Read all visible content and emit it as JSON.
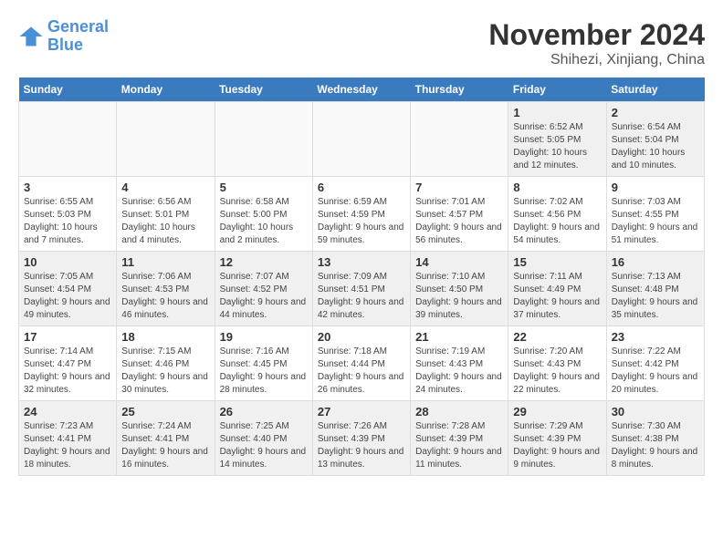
{
  "header": {
    "logo_line1": "General",
    "logo_line2": "Blue",
    "month": "November 2024",
    "location": "Shihezi, Xinjiang, China"
  },
  "weekdays": [
    "Sunday",
    "Monday",
    "Tuesday",
    "Wednesday",
    "Thursday",
    "Friday",
    "Saturday"
  ],
  "weeks": [
    [
      {
        "day": "",
        "info": ""
      },
      {
        "day": "",
        "info": ""
      },
      {
        "day": "",
        "info": ""
      },
      {
        "day": "",
        "info": ""
      },
      {
        "day": "",
        "info": ""
      },
      {
        "day": "1",
        "info": "Sunrise: 6:52 AM\nSunset: 5:05 PM\nDaylight: 10 hours and 12 minutes."
      },
      {
        "day": "2",
        "info": "Sunrise: 6:54 AM\nSunset: 5:04 PM\nDaylight: 10 hours and 10 minutes."
      }
    ],
    [
      {
        "day": "3",
        "info": "Sunrise: 6:55 AM\nSunset: 5:03 PM\nDaylight: 10 hours and 7 minutes."
      },
      {
        "day": "4",
        "info": "Sunrise: 6:56 AM\nSunset: 5:01 PM\nDaylight: 10 hours and 4 minutes."
      },
      {
        "day": "5",
        "info": "Sunrise: 6:58 AM\nSunset: 5:00 PM\nDaylight: 10 hours and 2 minutes."
      },
      {
        "day": "6",
        "info": "Sunrise: 6:59 AM\nSunset: 4:59 PM\nDaylight: 9 hours and 59 minutes."
      },
      {
        "day": "7",
        "info": "Sunrise: 7:01 AM\nSunset: 4:57 PM\nDaylight: 9 hours and 56 minutes."
      },
      {
        "day": "8",
        "info": "Sunrise: 7:02 AM\nSunset: 4:56 PM\nDaylight: 9 hours and 54 minutes."
      },
      {
        "day": "9",
        "info": "Sunrise: 7:03 AM\nSunset: 4:55 PM\nDaylight: 9 hours and 51 minutes."
      }
    ],
    [
      {
        "day": "10",
        "info": "Sunrise: 7:05 AM\nSunset: 4:54 PM\nDaylight: 9 hours and 49 minutes."
      },
      {
        "day": "11",
        "info": "Sunrise: 7:06 AM\nSunset: 4:53 PM\nDaylight: 9 hours and 46 minutes."
      },
      {
        "day": "12",
        "info": "Sunrise: 7:07 AM\nSunset: 4:52 PM\nDaylight: 9 hours and 44 minutes."
      },
      {
        "day": "13",
        "info": "Sunrise: 7:09 AM\nSunset: 4:51 PM\nDaylight: 9 hours and 42 minutes."
      },
      {
        "day": "14",
        "info": "Sunrise: 7:10 AM\nSunset: 4:50 PM\nDaylight: 9 hours and 39 minutes."
      },
      {
        "day": "15",
        "info": "Sunrise: 7:11 AM\nSunset: 4:49 PM\nDaylight: 9 hours and 37 minutes."
      },
      {
        "day": "16",
        "info": "Sunrise: 7:13 AM\nSunset: 4:48 PM\nDaylight: 9 hours and 35 minutes."
      }
    ],
    [
      {
        "day": "17",
        "info": "Sunrise: 7:14 AM\nSunset: 4:47 PM\nDaylight: 9 hours and 32 minutes."
      },
      {
        "day": "18",
        "info": "Sunrise: 7:15 AM\nSunset: 4:46 PM\nDaylight: 9 hours and 30 minutes."
      },
      {
        "day": "19",
        "info": "Sunrise: 7:16 AM\nSunset: 4:45 PM\nDaylight: 9 hours and 28 minutes."
      },
      {
        "day": "20",
        "info": "Sunrise: 7:18 AM\nSunset: 4:44 PM\nDaylight: 9 hours and 26 minutes."
      },
      {
        "day": "21",
        "info": "Sunrise: 7:19 AM\nSunset: 4:43 PM\nDaylight: 9 hours and 24 minutes."
      },
      {
        "day": "22",
        "info": "Sunrise: 7:20 AM\nSunset: 4:43 PM\nDaylight: 9 hours and 22 minutes."
      },
      {
        "day": "23",
        "info": "Sunrise: 7:22 AM\nSunset: 4:42 PM\nDaylight: 9 hours and 20 minutes."
      }
    ],
    [
      {
        "day": "24",
        "info": "Sunrise: 7:23 AM\nSunset: 4:41 PM\nDaylight: 9 hours and 18 minutes."
      },
      {
        "day": "25",
        "info": "Sunrise: 7:24 AM\nSunset: 4:41 PM\nDaylight: 9 hours and 16 minutes."
      },
      {
        "day": "26",
        "info": "Sunrise: 7:25 AM\nSunset: 4:40 PM\nDaylight: 9 hours and 14 minutes."
      },
      {
        "day": "27",
        "info": "Sunrise: 7:26 AM\nSunset: 4:39 PM\nDaylight: 9 hours and 13 minutes."
      },
      {
        "day": "28",
        "info": "Sunrise: 7:28 AM\nSunset: 4:39 PM\nDaylight: 9 hours and 11 minutes."
      },
      {
        "day": "29",
        "info": "Sunrise: 7:29 AM\nSunset: 4:39 PM\nDaylight: 9 hours and 9 minutes."
      },
      {
        "day": "30",
        "info": "Sunrise: 7:30 AM\nSunset: 4:38 PM\nDaylight: 9 hours and 8 minutes."
      }
    ]
  ]
}
